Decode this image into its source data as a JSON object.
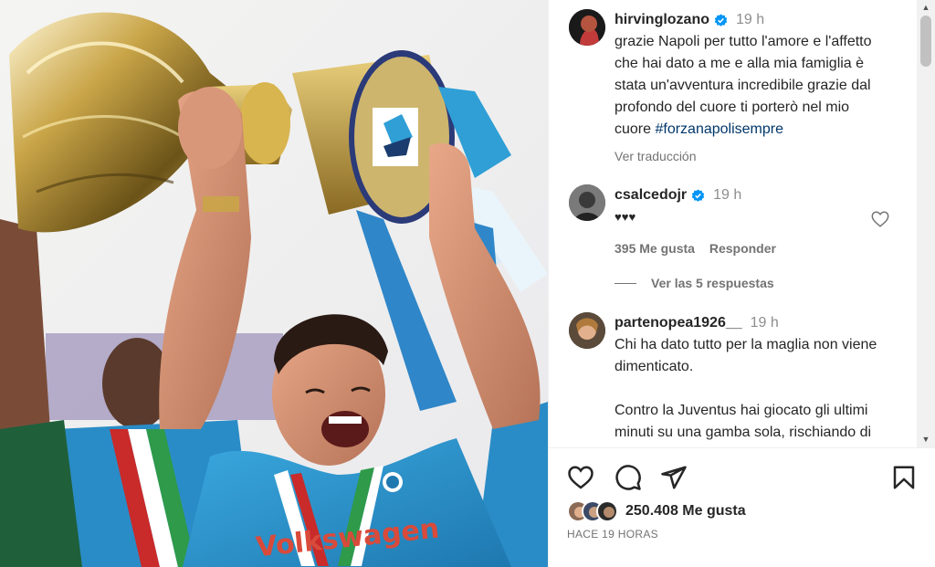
{
  "post": {
    "username": "hirvinglozano",
    "time": "19 h",
    "caption": "grazie Napoli per tutto l'amore e l'affetto che hai dato a me e alla mia famiglia è stata un'avventura incredibile grazie dal profondo del cuore ti porterò nel mio cuore ",
    "hashtag": "#forzanapolisempre",
    "translate": "Ver traducción"
  },
  "comments": [
    {
      "username": "csalcedojr",
      "time": "19 h",
      "text": "♥♥♥",
      "likes": "395 Me gusta",
      "reply": "Responder",
      "view_replies": "Ver las 5 respuestas"
    },
    {
      "username": "partenopea1926__",
      "time": "19 h",
      "text": "Chi ha dato tutto per la maglia non viene dimenticato.\n\nContro la Juventus hai giocato gli ultimi minuti su una gamba sola, rischiando di compromettere la"
    }
  ],
  "actions": {
    "likes_count": "250.408 Me gusta",
    "posted_time": "HACE 19 HORAS"
  },
  "icons": {
    "like": "heart-icon",
    "comment": "comment-icon",
    "share": "share-icon",
    "save": "bookmark-icon",
    "verified": "verified-badge-icon"
  },
  "colors": {
    "verified_blue": "#0095f6",
    "hashtag": "#00376b",
    "jersey": "#2f9fd6"
  },
  "photo": {
    "jersey_text": "Volkswagen"
  }
}
